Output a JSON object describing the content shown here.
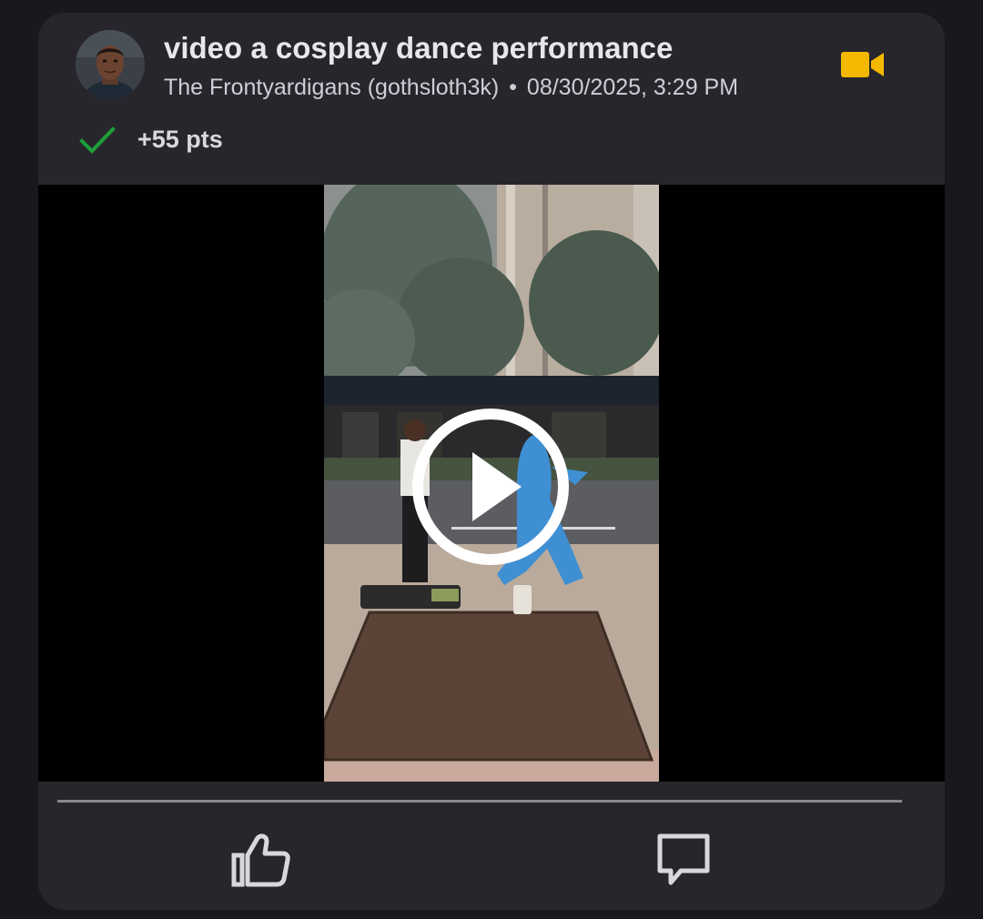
{
  "post": {
    "title": "video a cosplay dance performance",
    "author": "The Frontyardigans (gothsloth3k)",
    "separator": "•",
    "timestamp": "08/30/2025, 3:29 PM",
    "type_icon": "video-camera-icon",
    "status_icon": "checkmark-icon",
    "points": "+55 pts"
  },
  "media": {
    "kind": "video",
    "playback_progress": 0,
    "play_icon": "play-icon"
  },
  "actions": {
    "like_icon": "thumbs-up-icon",
    "comment_icon": "comment-icon"
  },
  "colors": {
    "card_background": "#27262c",
    "page_background": "#19181d",
    "video_icon": "#f5b800",
    "check_icon": "#1f9e3a",
    "text_primary": "#e7e6ec",
    "text_secondary": "#cfced6"
  }
}
